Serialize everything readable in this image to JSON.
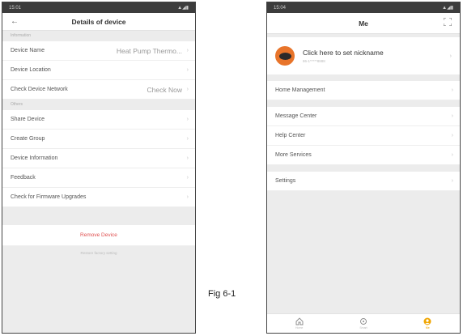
{
  "left_screen": {
    "status": {
      "time": "15:01",
      "icons": "▲◢▮"
    },
    "header": {
      "title": "Details of device",
      "back_icon": "arrow-left-icon"
    },
    "sections": [
      {
        "header": "Information",
        "rows": [
          {
            "label": "Device Name",
            "value": "Heat Pump Thermo..."
          },
          {
            "label": "Device Location",
            "value": ""
          },
          {
            "label": "Check Device Network",
            "value": "Check Now"
          }
        ]
      },
      {
        "header": "Others",
        "rows": [
          {
            "label": "Share Device",
            "value": ""
          },
          {
            "label": "Create Group",
            "value": ""
          },
          {
            "label": "Device Information",
            "value": ""
          },
          {
            "label": "Feedback",
            "value": ""
          },
          {
            "label": "Check for Firmware Upgrades",
            "value": ""
          }
        ]
      }
    ],
    "remove_label": "Remove Device",
    "remove_sub": "Restore factory setting"
  },
  "right_screen": {
    "status": {
      "time": "15:04",
      "icons": "▲◢▮"
    },
    "header": {
      "title": "Me",
      "scan_icon": "scan-icon"
    },
    "profile": {
      "nickname": "Click here to set nickname",
      "subtitle": "86-1*****8888"
    },
    "groups": [
      [
        {
          "label": "Home Management"
        }
      ],
      [
        {
          "label": "Message Center"
        },
        {
          "label": "Help Center"
        },
        {
          "label": "More Services"
        }
      ],
      [
        {
          "label": "Settings"
        }
      ]
    ],
    "tabs": [
      {
        "label": "Home",
        "icon": "home-icon",
        "active": false
      },
      {
        "label": "Smart",
        "icon": "smart-icon",
        "active": false
      },
      {
        "label": "Me",
        "icon": "me-icon",
        "active": true
      }
    ]
  },
  "caption": "Fig 6-1",
  "colors": {
    "accent": "#f0a500",
    "danger": "#e05050",
    "avatar": "#e8742a"
  }
}
